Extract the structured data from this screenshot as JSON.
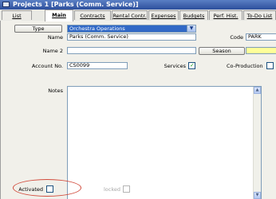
{
  "window": {
    "title": "Projects 1 [Parks (Comm. Service)]"
  },
  "tabs": [
    {
      "label": "List"
    },
    {
      "label": "Main"
    },
    {
      "label": "Contracts"
    },
    {
      "label": "Rental Contr."
    },
    {
      "label": "Expenses"
    },
    {
      "label": "Budgets"
    },
    {
      "label": "Perf. Hist."
    },
    {
      "label": "To-Do List"
    }
  ],
  "form": {
    "type_button": "Type",
    "type_value": "Orchestra Operations",
    "name_label": "Name",
    "name_value": "Parks (Comm. Service)",
    "code_label": "Code",
    "code_value": "PARK",
    "name2_label": "Name 2",
    "name2_value": "",
    "season_button": "Season",
    "account_label": "Account No.",
    "account_value": "CS0099",
    "services_label": "Services",
    "services_checked": true,
    "coproduction_label": "Co-Production",
    "coproduction_checked": false,
    "notes_label": "Notes",
    "notes_value": "",
    "activated_label": "Activated",
    "activated_checked": false,
    "locked_label": "locked",
    "locked_checked": false
  },
  "colors": {
    "title_bar": "#2d4f9c",
    "combo_highlight": "#3169c6",
    "season_field": "#ffff99",
    "annotation": "#d24b3c"
  }
}
